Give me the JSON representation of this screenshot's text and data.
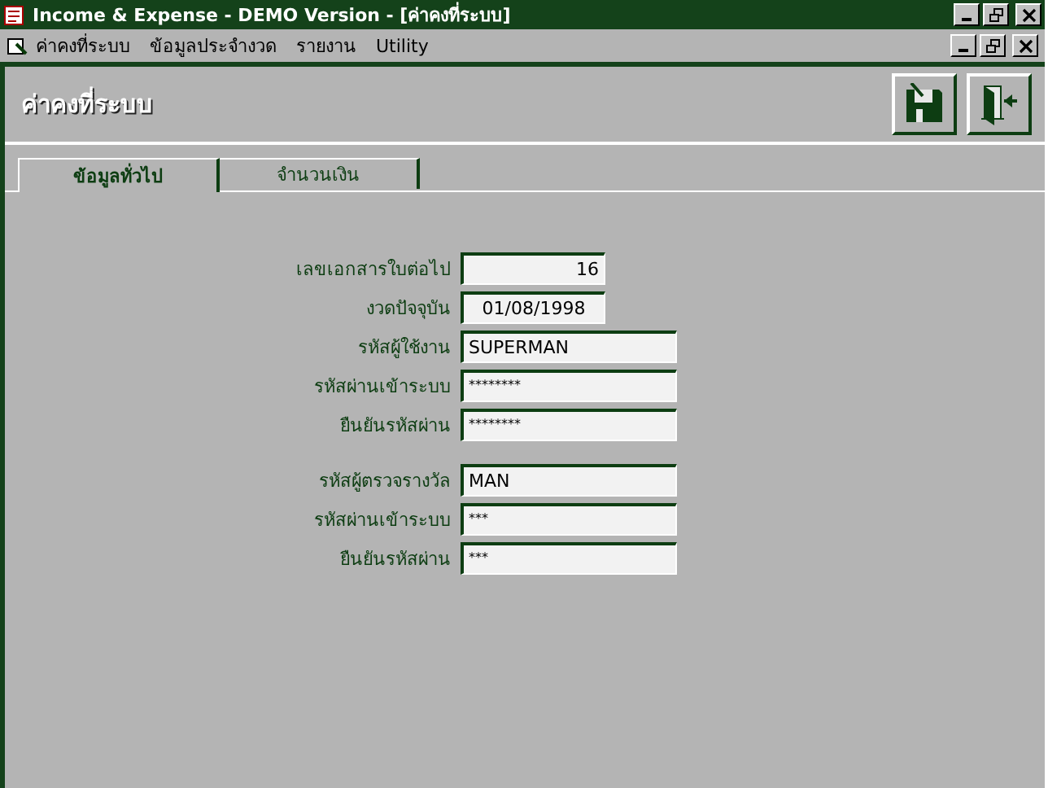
{
  "window": {
    "title": "Income & Expense - DEMO Version - [ค่าคงที่ระบบ]"
  },
  "menu": [
    "ค่าคงที่ระบบ",
    "ข้อมูลประจำงวด",
    "รายงาน",
    "Utility"
  ],
  "form": {
    "title": "ค่าคงที่ระบบ"
  },
  "tabs": [
    {
      "label": "ข้อมูลทั่วไป",
      "selected": true
    },
    {
      "label": "จำนวนเงิน",
      "selected": false
    }
  ],
  "groups": [
    [
      {
        "label": "เลขเอกสารใบต่อไป",
        "value": "16",
        "kind": "number"
      },
      {
        "label": "งวดปัจจุบัน",
        "value": "01/08/1998",
        "kind": "date"
      },
      {
        "label": "รหัสผู้ใช้งาน",
        "value": "SUPERMAN",
        "kind": "text"
      },
      {
        "label": "รหัสผ่านเข้าระบบ",
        "value": "********",
        "kind": "password"
      },
      {
        "label": "ยืนยันรหัสผ่าน",
        "value": "********",
        "kind": "password"
      }
    ],
    [
      {
        "label": "รหัสผู้ตรวจรางวัล",
        "value": "MAN",
        "kind": "text"
      },
      {
        "label": "รหัสผ่านเข้าระบบ",
        "value": "***",
        "kind": "password"
      },
      {
        "label": "ยืนยันรหัสผ่าน",
        "value": "***",
        "kind": "password"
      }
    ]
  ]
}
